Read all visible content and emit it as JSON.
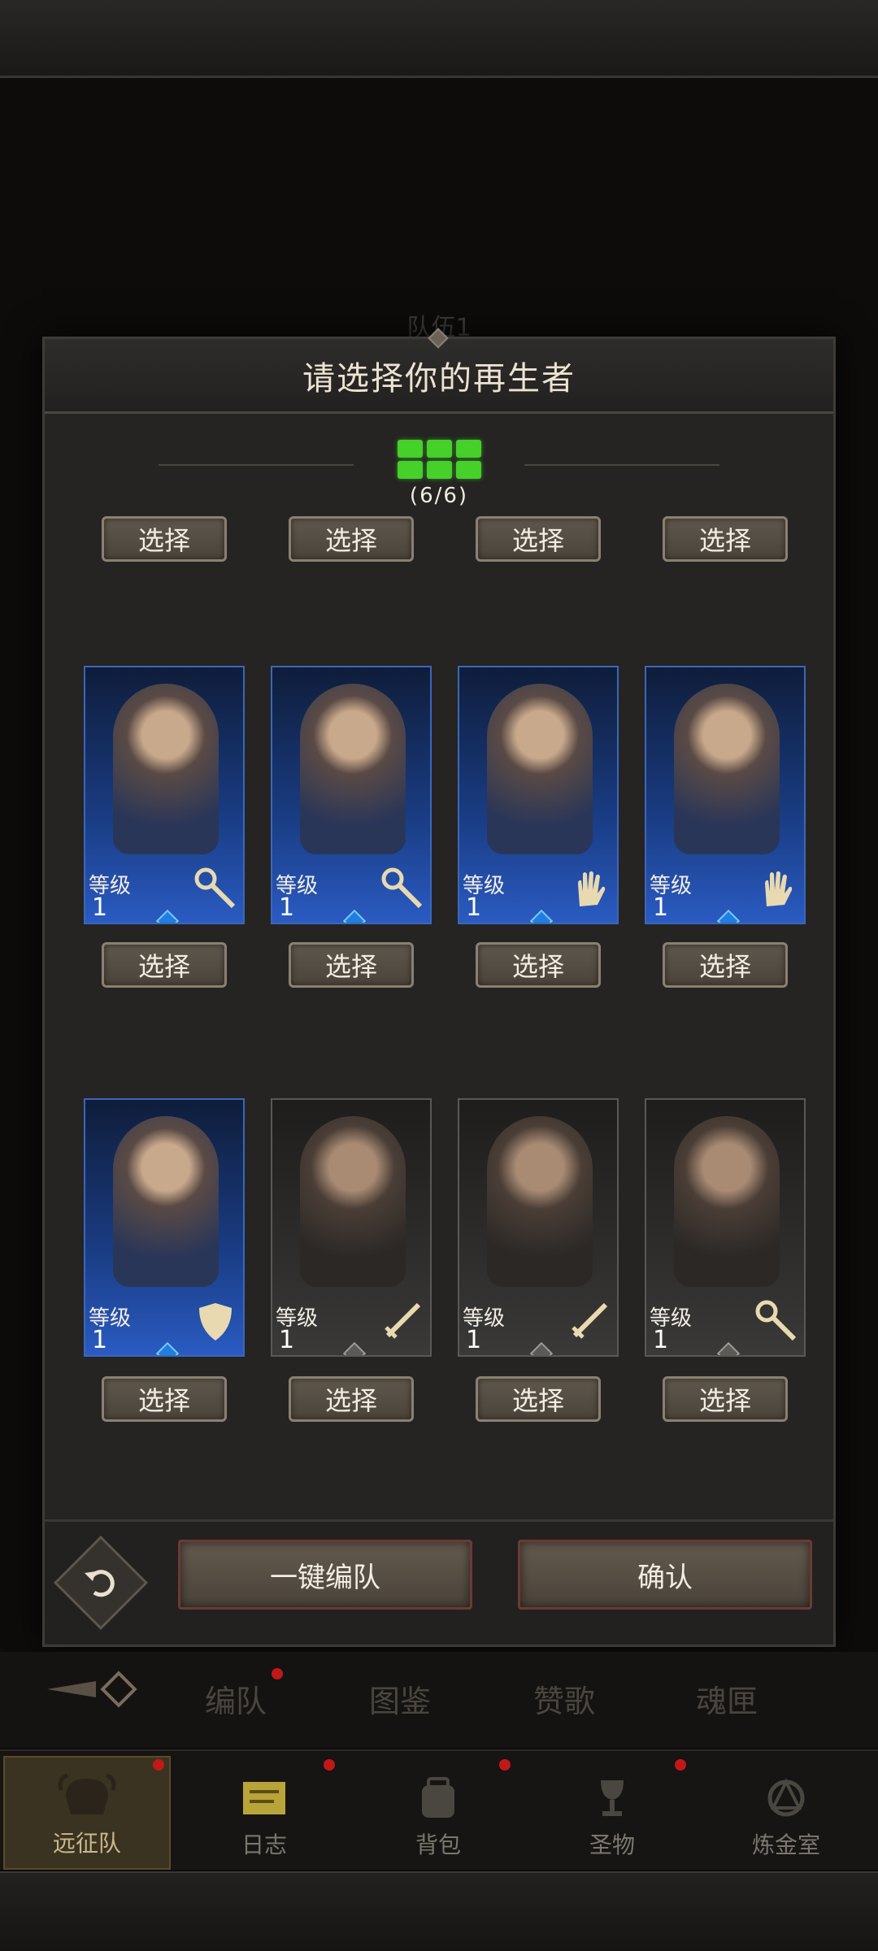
{
  "background": {
    "team_label": "队伍1"
  },
  "dialog": {
    "title": "请选择你的再生者",
    "progress_text": "(6/6)",
    "select_label": "选择",
    "auto_team_label": "一键编队",
    "confirm_label": "确认"
  },
  "characters": [
    {
      "level_label": "等级",
      "level": "1",
      "class_icon": "staff-icon",
      "rarity": "blue"
    },
    {
      "level_label": "等级",
      "level": "1",
      "class_icon": "staff-icon",
      "rarity": "blue"
    },
    {
      "level_label": "等级",
      "level": "1",
      "class_icon": "hand-icon",
      "rarity": "blue"
    },
    {
      "level_label": "等级",
      "level": "1",
      "class_icon": "hand-icon",
      "rarity": "blue"
    },
    {
      "level_label": "等级",
      "level": "1",
      "class_icon": "shield-icon",
      "rarity": "blue"
    },
    {
      "level_label": "等级",
      "level": "1",
      "class_icon": "sword-icon",
      "rarity": "gray"
    },
    {
      "level_label": "等级",
      "level": "1",
      "class_icon": "sword-icon",
      "rarity": "gray"
    },
    {
      "level_label": "等级",
      "level": "1",
      "class_icon": "staff-icon",
      "rarity": "gray"
    }
  ],
  "tabs": [
    {
      "label": "编队",
      "badge": true
    },
    {
      "label": "图鉴",
      "badge": false
    },
    {
      "label": "赞歌",
      "badge": false
    },
    {
      "label": "魂匣",
      "badge": false
    }
  ],
  "bottom_nav": [
    {
      "label": "远征队",
      "active": true,
      "icon": "helmet-icon"
    },
    {
      "label": "日志",
      "active": false,
      "icon": "scroll-icon"
    },
    {
      "label": "背包",
      "active": false,
      "icon": "backpack-icon"
    },
    {
      "label": "圣物",
      "active": false,
      "icon": "chalice-icon"
    },
    {
      "label": "炼金室",
      "active": false,
      "icon": "alchemy-icon"
    }
  ],
  "colors": {
    "progress_green": "#45d02a",
    "rare_blue": "#1f7fe0",
    "badge_red": "#c21818"
  }
}
